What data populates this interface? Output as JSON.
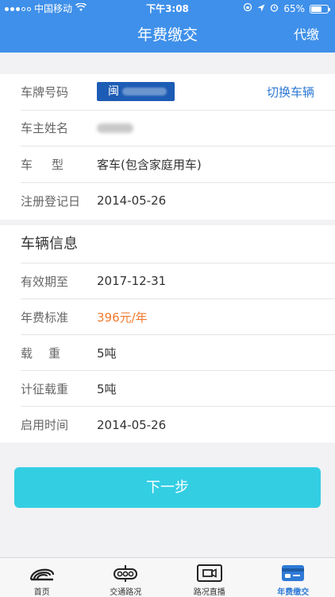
{
  "status_bar": {
    "carrier": "中国移动",
    "time": "下午3:08",
    "battery": "65%",
    "battery_level": 0.65
  },
  "nav": {
    "title": "年费缴交",
    "action": "代缴"
  },
  "vehicle": {
    "plate_label": "车牌号码",
    "plate_prefix": "闽",
    "switch_label": "切换车辆",
    "owner_label": "车主姓名",
    "type_label": "车型",
    "type_value": "客车(包含家庭用车)",
    "reg_date_label": "注册登记日",
    "reg_date_value": "2014-05-26"
  },
  "info": {
    "title": "车辆信息",
    "rows": [
      {
        "label": "有效期至",
        "value": "2017-12-31"
      },
      {
        "label": "年费标准",
        "value": "396元/年"
      },
      {
        "label": "载重",
        "value": "5吨"
      },
      {
        "label": "计征载重",
        "value": "5吨"
      },
      {
        "label": "启用时间",
        "value": "2014-05-26"
      }
    ]
  },
  "next_button": "下一步",
  "tabs": [
    {
      "label": "首页",
      "icon": "home-track-icon"
    },
    {
      "label": "交通路况",
      "icon": "traffic-icon"
    },
    {
      "label": "路况直播",
      "icon": "live-camera-icon"
    },
    {
      "label": "年费缴交",
      "icon": "annual-fee-icon"
    }
  ],
  "colors": {
    "header": "#3f90ea",
    "plate": "#1d5cb5",
    "accent_text": "#f27a2c",
    "link": "#2e78d3",
    "button": "#34cee3",
    "tab_active": "#2e7ad6"
  }
}
